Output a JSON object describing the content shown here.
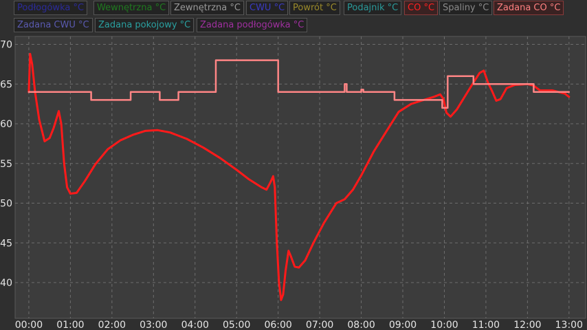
{
  "legend": {
    "items": [
      {
        "label": "Podłogówka °C",
        "color": "#2b2b9a",
        "active": false
      },
      {
        "label": "Wewnętrzna °C",
        "color": "#1f7a1f",
        "active": false
      },
      {
        "label": "Zewnętrzna °C",
        "color": "#9a9a9a",
        "active": false
      },
      {
        "label": "CWU °C",
        "color": "#3a3ac0",
        "active": false
      },
      {
        "label": "Powrót °C",
        "color": "#9a8a2a",
        "active": false
      },
      {
        "label": "Podajnik °C",
        "color": "#2a9a9a",
        "active": false
      },
      {
        "label": "CO °C",
        "color": "#ff2020",
        "active": true
      },
      {
        "label": "Spaliny °C",
        "color": "#8a8a8a",
        "active": false
      },
      {
        "label": "Zadana CO °C",
        "color": "#ff8080",
        "active": true
      },
      {
        "label": "Zadana CWU °C",
        "color": "#5a5ab0",
        "active": false
      },
      {
        "label": "Zadana pokojowy °C",
        "color": "#2aa0a0",
        "active": false
      },
      {
        "label": "Zadana podłogówka °C",
        "color": "#a030a0",
        "active": false
      }
    ]
  },
  "chart_data": {
    "type": "line",
    "ylim": [
      35.5,
      71
    ],
    "xlim": [
      -0.33,
      13.4
    ],
    "y_ticks": [
      40,
      45,
      50,
      55,
      60,
      65,
      70
    ],
    "x_ticks": [
      {
        "h": 0,
        "label": "00:00"
      },
      {
        "h": 1,
        "label": "01:00"
      },
      {
        "h": 2,
        "label": "02:00"
      },
      {
        "h": 3,
        "label": "03:00"
      },
      {
        "h": 4,
        "label": "04:00"
      },
      {
        "h": 5,
        "label": "05:00"
      },
      {
        "h": 6,
        "label": "06:00"
      },
      {
        "h": 7,
        "label": "07:00"
      },
      {
        "h": 8,
        "label": "08:00"
      },
      {
        "h": 9,
        "label": "09:00"
      },
      {
        "h": 10,
        "label": "10:00"
      },
      {
        "h": 11,
        "label": "11:00"
      },
      {
        "h": 12,
        "label": "12:00"
      },
      {
        "h": 13,
        "label": "13:00"
      }
    ],
    "grid": true,
    "series": [
      {
        "name": "CO °C",
        "color": "#ff1a1a",
        "step": false,
        "points": [
          [
            0.0,
            64
          ],
          [
            0.03,
            68.8
          ],
          [
            0.08,
            67.5
          ],
          [
            0.15,
            64
          ],
          [
            0.25,
            60.5
          ],
          [
            0.38,
            57.8
          ],
          [
            0.5,
            58.2
          ],
          [
            0.6,
            59.5
          ],
          [
            0.72,
            61.6
          ],
          [
            0.78,
            60
          ],
          [
            0.85,
            55
          ],
          [
            0.92,
            52
          ],
          [
            1.0,
            51.2
          ],
          [
            1.15,
            51.3
          ],
          [
            1.35,
            52.8
          ],
          [
            1.6,
            54.9
          ],
          [
            1.9,
            56.8
          ],
          [
            2.2,
            57.9
          ],
          [
            2.5,
            58.6
          ],
          [
            2.8,
            59.1
          ],
          [
            3.1,
            59.2
          ],
          [
            3.4,
            58.9
          ],
          [
            3.8,
            58.1
          ],
          [
            4.2,
            57
          ],
          [
            4.6,
            55.7
          ],
          [
            5.0,
            54.2
          ],
          [
            5.3,
            53
          ],
          [
            5.6,
            52
          ],
          [
            5.72,
            51.7
          ],
          [
            5.82,
            52.7
          ],
          [
            5.88,
            53.4
          ],
          [
            5.92,
            52
          ],
          [
            5.97,
            45
          ],
          [
            6.02,
            40
          ],
          [
            6.07,
            37.8
          ],
          [
            6.12,
            38.5
          ],
          [
            6.18,
            41.5
          ],
          [
            6.25,
            44
          ],
          [
            6.3,
            43.4
          ],
          [
            6.4,
            42
          ],
          [
            6.5,
            41.9
          ],
          [
            6.65,
            42.8
          ],
          [
            6.85,
            45
          ],
          [
            7.1,
            47.5
          ],
          [
            7.4,
            50
          ],
          [
            7.6,
            50.5
          ],
          [
            7.8,
            51.7
          ],
          [
            8.0,
            53.5
          ],
          [
            8.3,
            56.5
          ],
          [
            8.6,
            59
          ],
          [
            8.9,
            61.5
          ],
          [
            9.2,
            62.5
          ],
          [
            9.5,
            63
          ],
          [
            9.75,
            63.4
          ],
          [
            9.9,
            63.7
          ],
          [
            9.98,
            63.1
          ],
          [
            10.05,
            61.4
          ],
          [
            10.15,
            60.9
          ],
          [
            10.3,
            61.8
          ],
          [
            10.5,
            63.5
          ],
          [
            10.7,
            65.2
          ],
          [
            10.85,
            66.4
          ],
          [
            10.95,
            66.7
          ],
          [
            11.05,
            65.2
          ],
          [
            11.15,
            64.1
          ],
          [
            11.25,
            62.9
          ],
          [
            11.35,
            63.1
          ],
          [
            11.5,
            64.5
          ],
          [
            11.7,
            64.9
          ],
          [
            12.0,
            65
          ],
          [
            12.15,
            64.8
          ],
          [
            12.3,
            64.2
          ],
          [
            12.6,
            64.2
          ],
          [
            12.9,
            63.8
          ],
          [
            13.0,
            63.4
          ]
        ]
      },
      {
        "name": "Zadana CO °C",
        "color": "#ff8585",
        "step": true,
        "points": [
          [
            0.0,
            64
          ],
          [
            1.5,
            63
          ],
          [
            2.45,
            64
          ],
          [
            3.15,
            63
          ],
          [
            3.6,
            64
          ],
          [
            4.5,
            68
          ],
          [
            6.0,
            64
          ],
          [
            7.6,
            65
          ],
          [
            7.65,
            64
          ],
          [
            8.0,
            64.3
          ],
          [
            8.05,
            64
          ],
          [
            8.8,
            63
          ],
          [
            9.95,
            62
          ],
          [
            10.08,
            66
          ],
          [
            10.7,
            65
          ],
          [
            12.15,
            64
          ],
          [
            13.0,
            64
          ]
        ]
      }
    ]
  }
}
